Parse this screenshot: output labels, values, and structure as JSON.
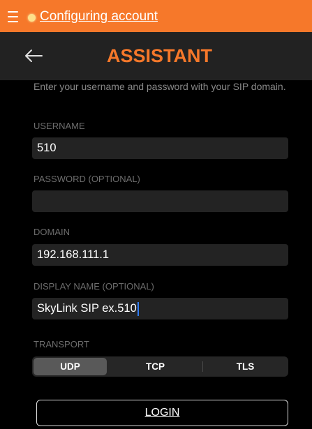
{
  "colors": {
    "accent": "#f6782a",
    "status_led": "#fde08a",
    "caret": "#2f7cf6",
    "header_bg": "#222222",
    "field_bg": "#232323"
  },
  "status_bar": {
    "menu_icon": "hamburger-menu-icon",
    "status_icon": "status-led-icon",
    "status_text": "Configuring account"
  },
  "header": {
    "back_icon": "back-arrow-icon",
    "title": "ASSISTANT"
  },
  "form": {
    "instructions": "Enter your username and password with your SIP domain.",
    "fields": [
      {
        "label": "USERNAME",
        "value": "510"
      },
      {
        "label": "PASSWORD (OPTIONAL)",
        "value": ""
      },
      {
        "label": "DOMAIN",
        "value": "192.168.111.1"
      },
      {
        "label": "DISPLAY NAME (OPTIONAL)",
        "value": "SkyLink SIP ex.510",
        "focused": true
      }
    ],
    "transport": {
      "label": "TRANSPORT",
      "options": [
        "UDP",
        "TCP",
        "TLS"
      ],
      "selected": "UDP"
    },
    "login_label": "LOGIN"
  }
}
